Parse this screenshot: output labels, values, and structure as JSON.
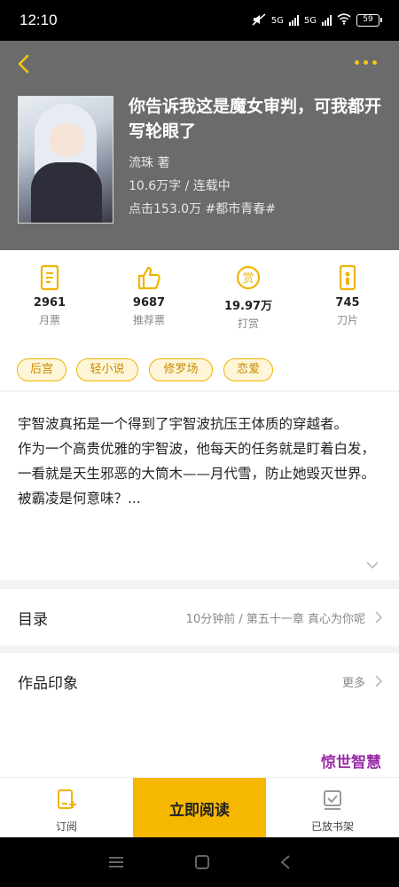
{
  "status_bar": {
    "time": "12:10",
    "network_1": "5G",
    "network_2": "5G",
    "battery": "59"
  },
  "book": {
    "title": "你告诉我这是魔女审判，可我都开写轮眼了",
    "author_line": "流珠  著",
    "word_status": "10.6万字 / 连载中",
    "clicks_genre": "点击153.0万  #都市青春#"
  },
  "stats": [
    {
      "value": "2961",
      "label": "月票",
      "icon": "monthly-ticket-icon"
    },
    {
      "value": "9687",
      "label": "推荐票",
      "icon": "thumbs-up-icon"
    },
    {
      "value": "19.97万",
      "label": "打赏",
      "icon": "reward-coin-icon"
    },
    {
      "value": "745",
      "label": "刀片",
      "icon": "blade-icon"
    }
  ],
  "tags": [
    "后宫",
    "轻小说",
    "修罗场",
    "恋爱"
  ],
  "description": {
    "line1": "宇智波真拓是一个得到了宇智波抗压王体质的穿越者。",
    "line2": "作为一个高贵优雅的宇智波，他每天的任务就是盯着白发，一看就是天生邪恶的大筒木——月代雪，防止她毁灭世界。",
    "line3": "被霸凌是何意味？..."
  },
  "toc": {
    "title": "目录",
    "latest": "10分钟前 / 第五十一章 真心为你呢"
  },
  "impression": {
    "title": "作品印象",
    "more": "更多",
    "floating_text": "惊世智慧"
  },
  "bottom_bar": {
    "subscribe": "订阅",
    "read_now": "立即阅读",
    "shelf": "已放书架"
  },
  "colors": {
    "accent": "#f5b700",
    "hero_bg": "#6b6b6b",
    "tag_text": "#c98a00"
  }
}
